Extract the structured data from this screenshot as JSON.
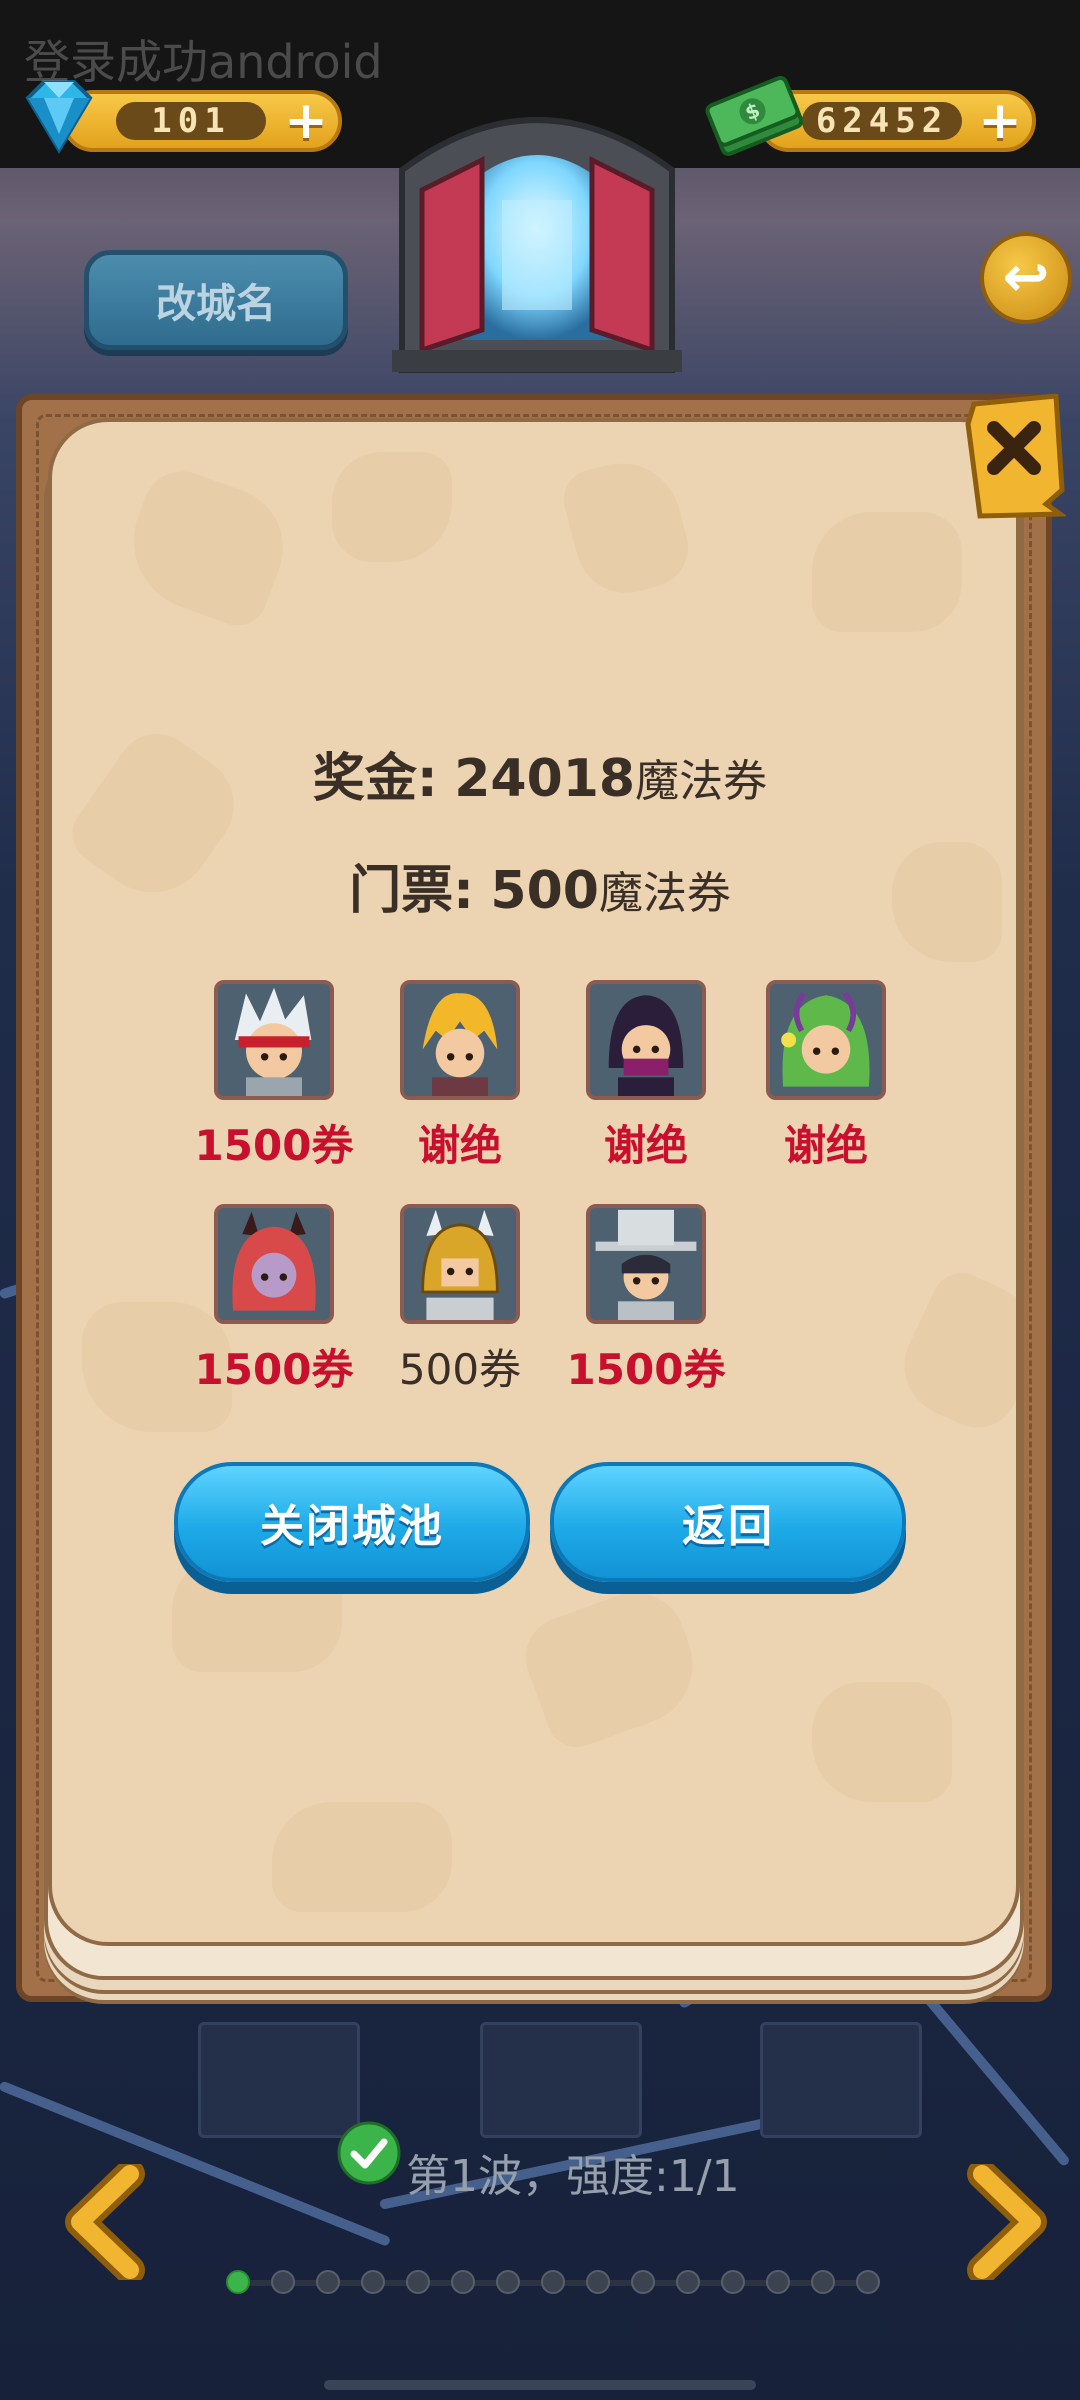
{
  "status_overlay": {
    "text": "登录成功android"
  },
  "resources": {
    "gems": {
      "value": "101",
      "icon": "diamond-icon"
    },
    "cash": {
      "value": "62452",
      "icon": "cash-stack-icon"
    },
    "add_icon": "plus-icon"
  },
  "header": {
    "rename_button": "改城名",
    "back_icon": "undo-arrow-icon"
  },
  "modal": {
    "close_icon": "close-x-icon",
    "prize": {
      "label": "奖金:",
      "amount": "24018",
      "unit": "魔法券"
    },
    "ticket": {
      "label": "门票:",
      "amount": "500",
      "unit": "魔法券"
    },
    "heroes": [
      {
        "icon": "hero-white-hair-ninja",
        "label": "1500券",
        "highlight": true
      },
      {
        "icon": "hero-blonde-rogue",
        "label": "谢绝",
        "highlight": true
      },
      {
        "icon": "hero-masked-kunoichi",
        "label": "谢绝",
        "highlight": true
      },
      {
        "icon": "hero-green-dryad",
        "label": "谢绝",
        "highlight": true
      },
      {
        "icon": "hero-red-demon-girl",
        "label": "1500券",
        "highlight": true
      },
      {
        "icon": "hero-golden-knight",
        "label": "500券",
        "highlight": false
      },
      {
        "icon": "hero-top-hat-gentleman",
        "label": "1500券",
        "highlight": true
      }
    ],
    "buttons": {
      "close_city": "关闭城池",
      "back": "返回"
    }
  },
  "wave": {
    "text": "第1波，强度:1/1",
    "check_icon": "check-circle-icon"
  },
  "navigation": {
    "prev_icon": "left-chevron-icon",
    "next_icon": "right-chevron-icon",
    "page_count": 15,
    "active_page": 1
  },
  "colors": {
    "highlight_red": "#c8102e",
    "button_blue": "#1eaae8",
    "paper": "#ecd4b2",
    "frame_brown": "#a2714a"
  }
}
